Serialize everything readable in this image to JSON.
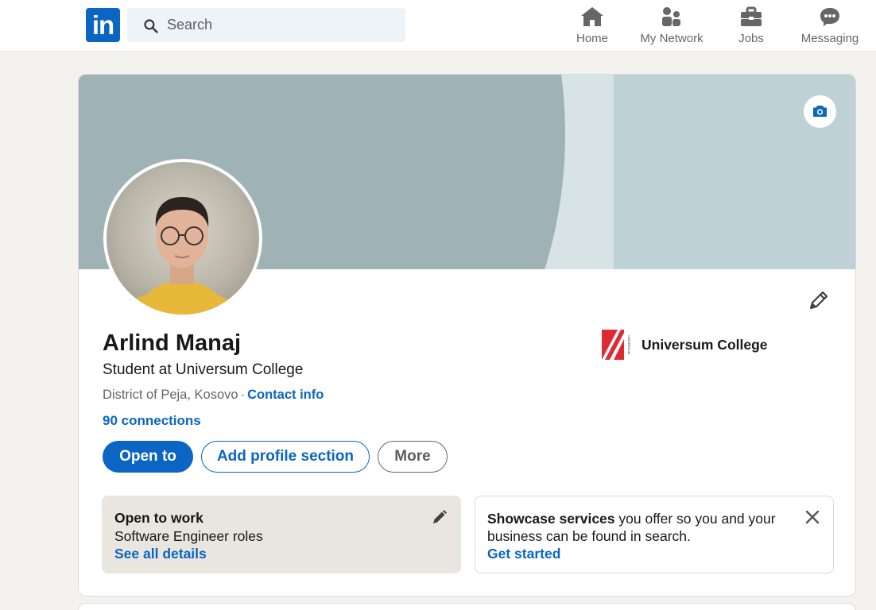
{
  "nav": {
    "logo_text": "in",
    "search_placeholder": "Search",
    "items": [
      {
        "label": "Home",
        "icon": "home-icon"
      },
      {
        "label": "My Network",
        "icon": "network-icon"
      },
      {
        "label": "Jobs",
        "icon": "briefcase-icon"
      },
      {
        "label": "Messaging",
        "icon": "messaging-icon"
      }
    ]
  },
  "profile": {
    "name": "Arlind Manaj",
    "headline": "Student at Universum College",
    "location": "District of Peja, Kosovo",
    "separator": "·",
    "contact_info": "Contact info",
    "connections": "90 connections",
    "organization": "Universum College",
    "org_logo_text": "UNIVERSUM"
  },
  "actions": {
    "open_to": "Open to",
    "add_section": "Add profile section",
    "more": "More"
  },
  "open_to_work": {
    "title": "Open to work",
    "roles": "Software Engineer roles",
    "link": "See all details"
  },
  "showcase": {
    "bold": "Showcase services",
    "rest": " you offer so you and your business can be found in search.",
    "link": "Get started"
  },
  "colors": {
    "brand": "#0a66c2",
    "banner": "#bed1d5",
    "open_to_work_bg": "#e9e5df"
  }
}
